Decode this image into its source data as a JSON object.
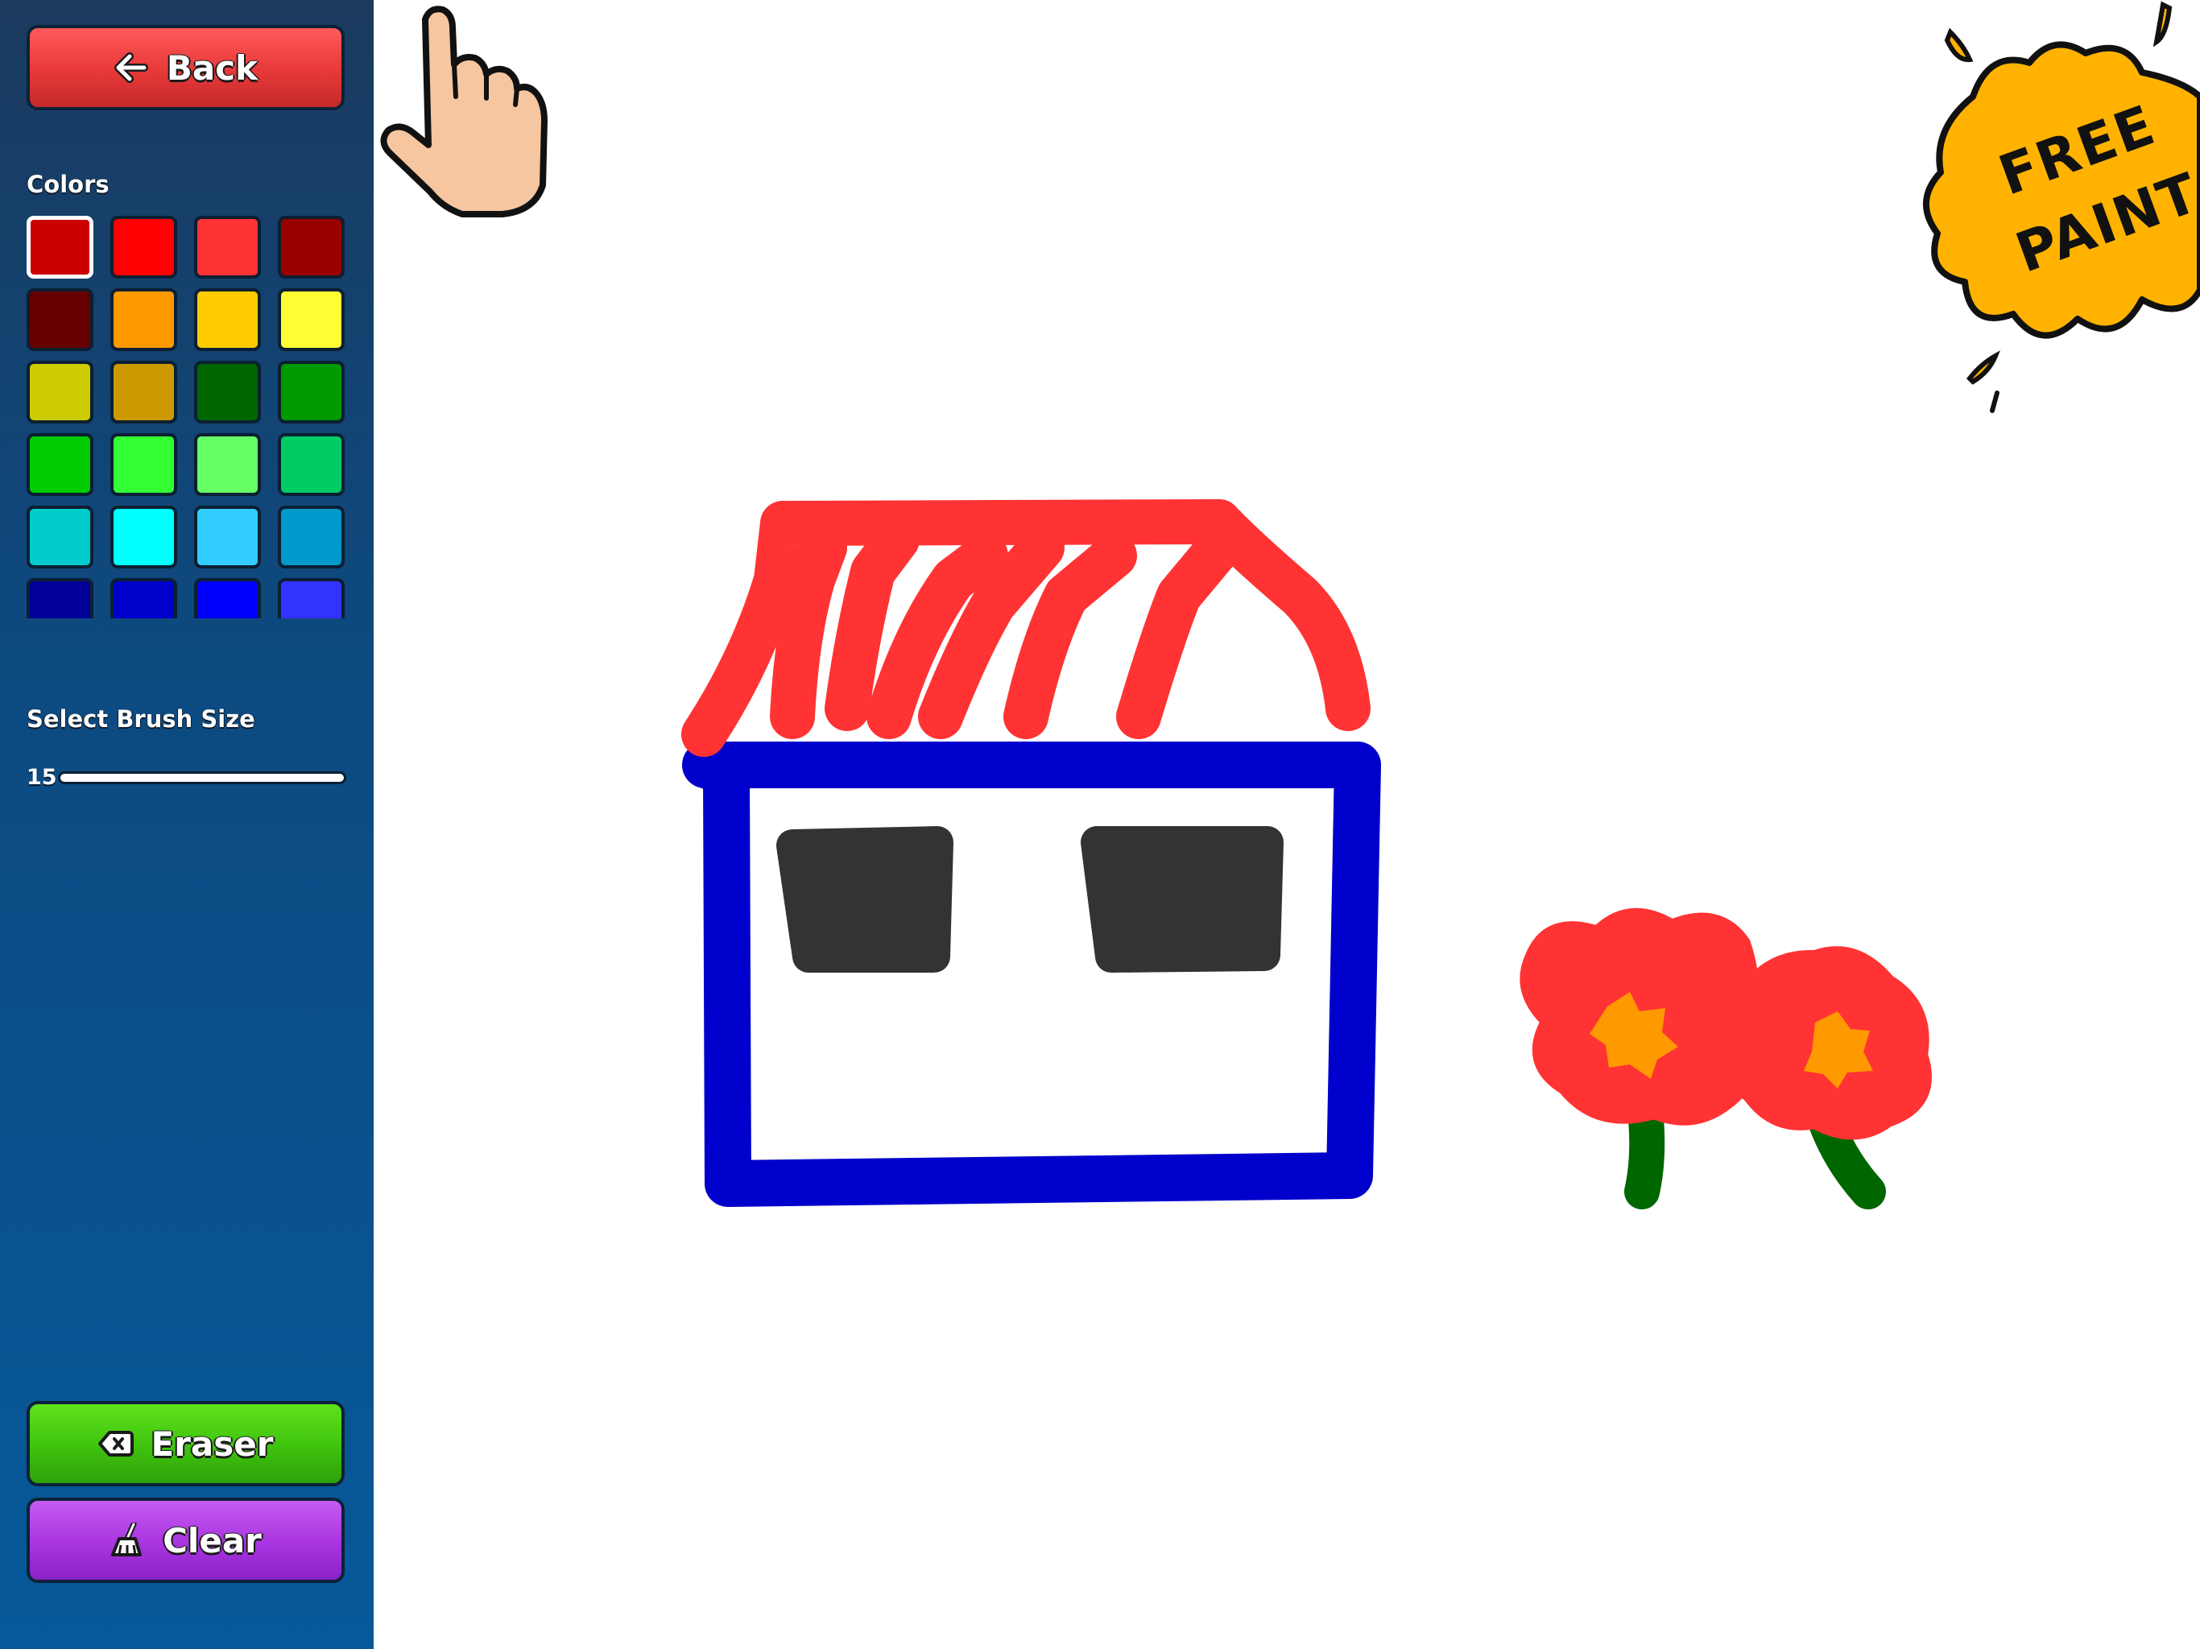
{
  "sidebar": {
    "back_label": "Back",
    "colors_label": "Colors",
    "brush_label": "Select Brush Size",
    "brush_size": "15",
    "eraser_label": "Eraser",
    "clear_label": "Clear",
    "palette": [
      "#cc0000",
      "#ff0000",
      "#ff3333",
      "#990000",
      "#660000",
      "#ff9900",
      "#ffcc00",
      "#ffff33",
      "#cccc00",
      "#cc9900",
      "#006600",
      "#009900",
      "#00cc00",
      "#33ff33",
      "#66ff66",
      "#00cc66",
      "#00cccc",
      "#00ffff",
      "#33ccff",
      "#0099cc",
      "#000099",
      "#0000cc",
      "#0000ff",
      "#3333ff"
    ],
    "selected_color": "#cc0000"
  },
  "badge": {
    "line1": "FREE",
    "line2": "PAINT"
  },
  "colors": {
    "house_outline": "#0000cc",
    "roof": "#ff3333",
    "windows": "#333333",
    "flower_petals": "#ff3333",
    "flower_center": "#ff9900",
    "stems": "#006600",
    "badge_fill": "#ffb300"
  }
}
